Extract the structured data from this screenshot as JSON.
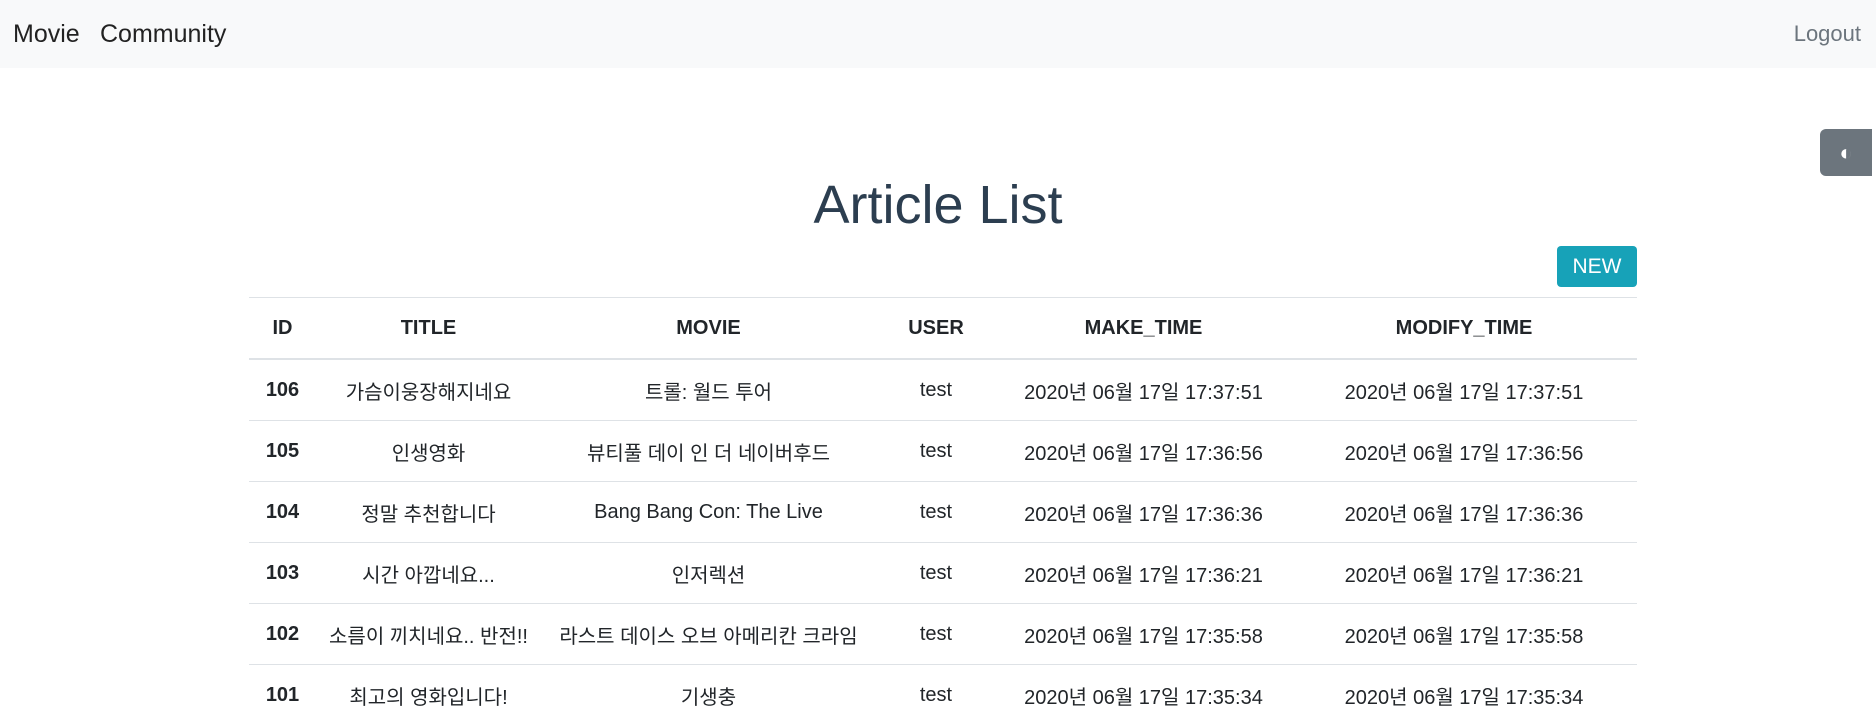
{
  "nav": {
    "movie": "Movie",
    "community": "Community",
    "logout": "Logout"
  },
  "theme_toggle": {
    "icon": "◐"
  },
  "page": {
    "title": "Article List",
    "new_label": "NEW"
  },
  "table": {
    "headers": [
      "ID",
      "TITLE",
      "MOVIE",
      "USER",
      "MAKE_TIME",
      "MODIFY_TIME"
    ],
    "rows": [
      {
        "id": "106",
        "title": "가슴이웅장해지네요",
        "movie": "트롤: 월드 투어",
        "user": "test",
        "make_time": "2020년 06월 17일 17:37:51",
        "modify_time": "2020년 06월 17일 17:37:51"
      },
      {
        "id": "105",
        "title": "인생영화",
        "movie": "뷰티풀 데이 인 더 네이버후드",
        "user": "test",
        "make_time": "2020년 06월 17일 17:36:56",
        "modify_time": "2020년 06월 17일 17:36:56"
      },
      {
        "id": "104",
        "title": "정말 추천합니다",
        "movie": "Bang Bang Con: The Live",
        "user": "test",
        "make_time": "2020년 06월 17일 17:36:36",
        "modify_time": "2020년 06월 17일 17:36:36"
      },
      {
        "id": "103",
        "title": "시간 아깝네요...",
        "movie": "인저렉션",
        "user": "test",
        "make_time": "2020년 06월 17일 17:36:21",
        "modify_time": "2020년 06월 17일 17:36:21"
      },
      {
        "id": "102",
        "title": "소름이 끼치네요.. 반전!!",
        "movie": "라스트 데이스 오브 아메리칸 크라임",
        "user": "test",
        "make_time": "2020년 06월 17일 17:35:58",
        "modify_time": "2020년 06월 17일 17:35:58"
      },
      {
        "id": "101",
        "title": "최고의 영화입니다!",
        "movie": "기생충",
        "user": "test",
        "make_time": "2020년 06월 17일 17:35:34",
        "modify_time": "2020년 06월 17일 17:35:34"
      }
    ]
  }
}
